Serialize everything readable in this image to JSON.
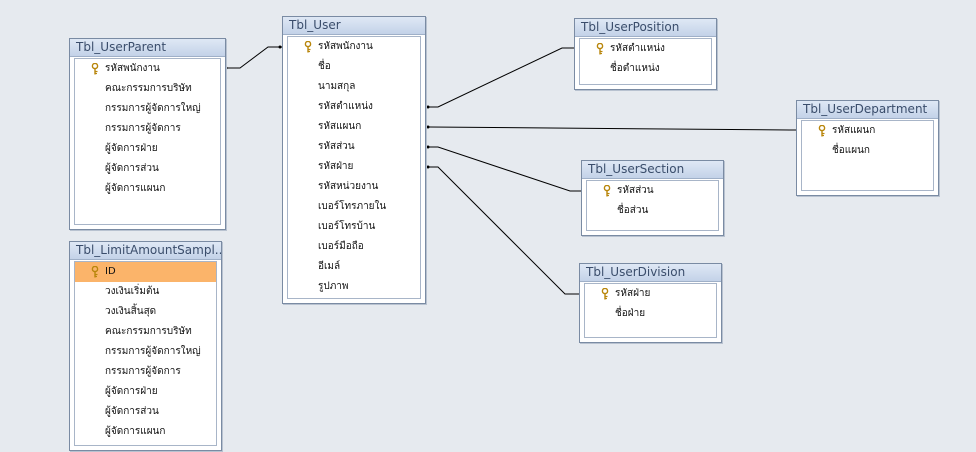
{
  "colors": {
    "background": "#e6eaef",
    "title_text": "#3a4d6b",
    "selected_row": "#fbb46a",
    "line": "#000000"
  },
  "tables": [
    {
      "id": "parent",
      "title": "Tbl_UserParent",
      "fields": [
        {
          "name": "รหัสพนักงาน",
          "key": true
        },
        {
          "name": "คณะกรรมการบริษัท"
        },
        {
          "name": "กรรมการผู้จัดการใหญ่"
        },
        {
          "name": "กรรมการผู้จัดการ"
        },
        {
          "name": "ผู้จัดการฝ่าย"
        },
        {
          "name": "ผู้จัดการส่วน"
        },
        {
          "name": "ผู้จัดการแผนก"
        }
      ]
    },
    {
      "id": "limit",
      "title": "Tbl_LimitAmountSampl...",
      "fields": [
        {
          "name": "ID",
          "key": true,
          "selected": true
        },
        {
          "name": "วงเงินเริ่มต้น"
        },
        {
          "name": "วงเงินสิ้นสุด"
        },
        {
          "name": "คณะกรรมการบริษัท"
        },
        {
          "name": "กรรมการผู้จัดการใหญ่"
        },
        {
          "name": "กรรมการผู้จัดการ"
        },
        {
          "name": "ผู้จัดการฝ่าย"
        },
        {
          "name": "ผู้จัดการส่วน"
        },
        {
          "name": "ผู้จัดการแผนก"
        }
      ]
    },
    {
      "id": "user",
      "title": "Tbl_User",
      "fields": [
        {
          "name": "รหัสพนักงาน",
          "key": true
        },
        {
          "name": "ชื่อ"
        },
        {
          "name": "นามสกุล"
        },
        {
          "name": "รหัสตำแหน่ง"
        },
        {
          "name": "รหัสแผนก"
        },
        {
          "name": "รหัสส่วน"
        },
        {
          "name": "รหัสฝ่าย"
        },
        {
          "name": "รหัสหน่วยงาน"
        },
        {
          "name": "เบอร์โทรภายใน"
        },
        {
          "name": "เบอร์โทรบ้าน"
        },
        {
          "name": "เบอร์มือถือ"
        },
        {
          "name": "อีเมล์"
        },
        {
          "name": "รูปภาพ"
        }
      ]
    },
    {
      "id": "position",
      "title": "Tbl_UserPosition",
      "fields": [
        {
          "name": "รหัสตำแหน่ง",
          "key": true
        },
        {
          "name": "ชื่อตำแหน่ง"
        }
      ]
    },
    {
      "id": "department",
      "title": "Tbl_UserDepartment",
      "fields": [
        {
          "name": "รหัสแผนก",
          "key": true
        },
        {
          "name": "ชื่อแผนก"
        }
      ]
    },
    {
      "id": "section",
      "title": "Tbl_UserSection",
      "fields": [
        {
          "name": "รหัสส่วน",
          "key": true
        },
        {
          "name": "ชื่อส่วน"
        }
      ]
    },
    {
      "id": "division",
      "title": "Tbl_UserDivision",
      "fields": [
        {
          "name": "รหัสฝ่าย",
          "key": true
        },
        {
          "name": "ชื่อฝ่าย"
        }
      ]
    }
  ]
}
